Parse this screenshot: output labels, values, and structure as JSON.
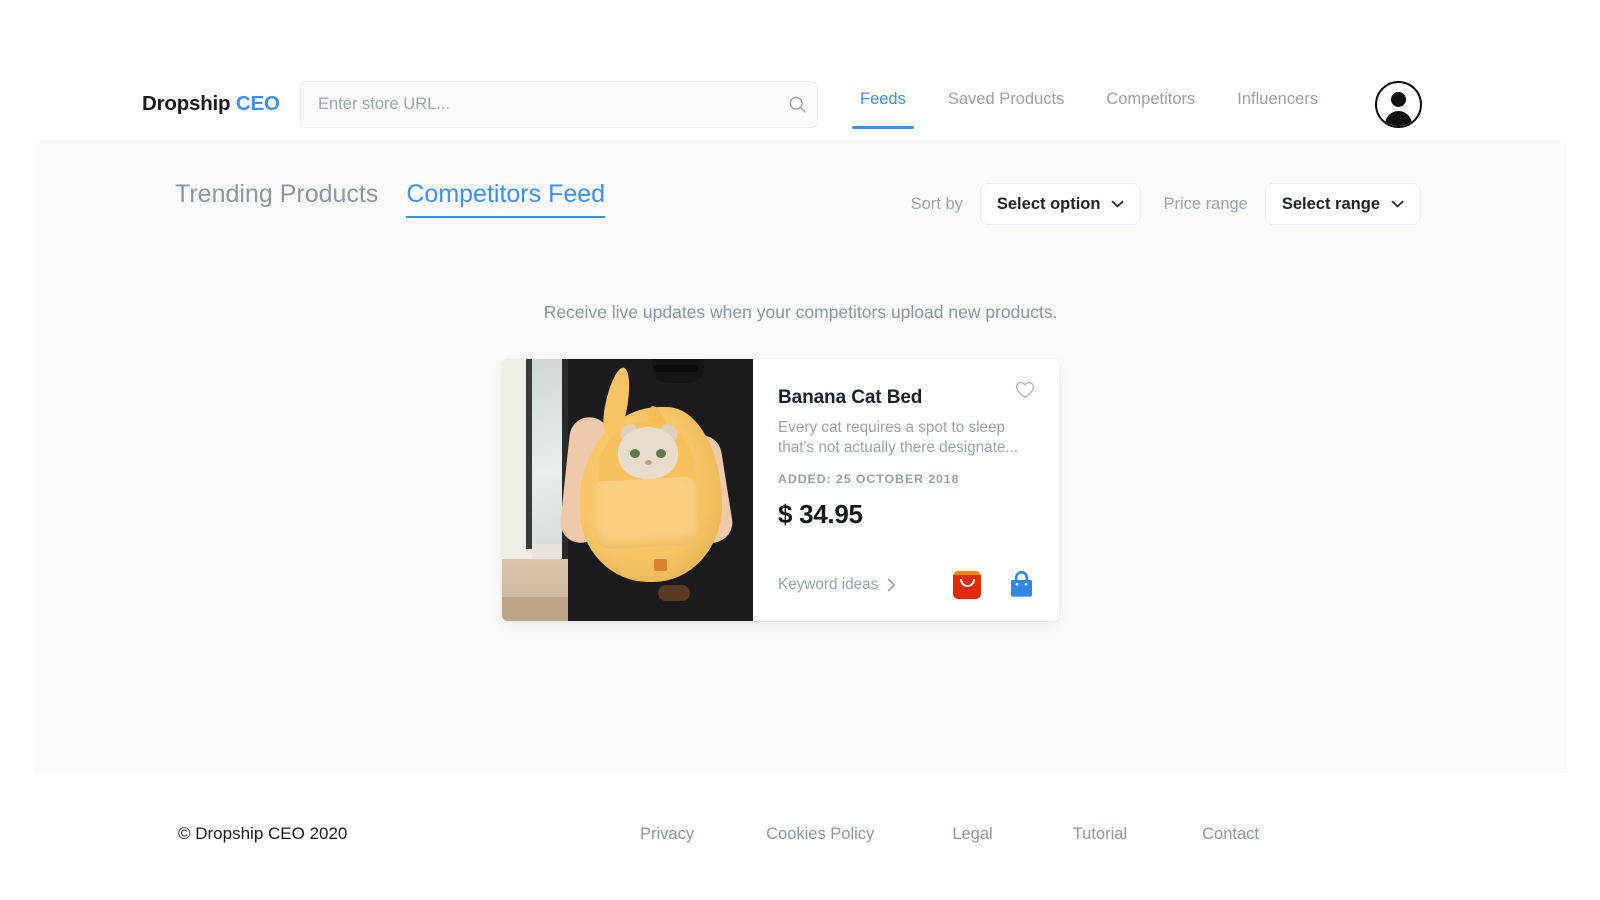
{
  "header": {
    "brand_main": "Dropship",
    "brand_accent": "CEO",
    "search": {
      "placeholder": "Enter store URL...",
      "value": "",
      "icon": "search-icon"
    },
    "nav": [
      {
        "label": "Feeds",
        "active": true
      },
      {
        "label": "Saved Products",
        "active": false
      },
      {
        "label": "Competitors",
        "active": false
      },
      {
        "label": "Influencers",
        "active": false
      }
    ],
    "avatar_icon": "user-avatar-icon"
  },
  "toolbar": {
    "tabs": [
      {
        "label": "Trending Products",
        "active": false
      },
      {
        "label": "Competitors Feed",
        "active": true
      }
    ],
    "sort_label": "Sort by",
    "sort_value": "Select option",
    "price_label": "Price range",
    "price_value": "Select range",
    "chevron_icon": "chevron-down-icon"
  },
  "main": {
    "subtitle": "Receive live updates when your competitors upload new products.",
    "product": {
      "title": "Banana Cat Bed",
      "description": "Every cat requires a spot to sleep that's not actually there designate...",
      "added": "ADDED: 25 OCTOBER 2018",
      "price": "$ 34.95",
      "keyword_link": "Keyword ideas",
      "heart_icon": "heart-outline-icon",
      "arrow_icon": "chevron-right-icon",
      "aliexpress_icon": "aliexpress-icon",
      "shopify_icon": "shopping-bag-icon",
      "image_alt": "person holding yellow banana shaped cat bed with cat inside"
    }
  },
  "footer": {
    "copyright": "© Dropship CEO 2020",
    "links": [
      "Privacy",
      "Cookies Policy",
      "Legal",
      "Tutorial",
      "Contact"
    ]
  },
  "colors": {
    "accent": "#3b90f5",
    "muted": "#98a2ae",
    "panel_bg": "#fafafa",
    "text_dark": "#17202b",
    "aliexpress": "#e62e04",
    "shopify_bag": "#2f88e8"
  }
}
